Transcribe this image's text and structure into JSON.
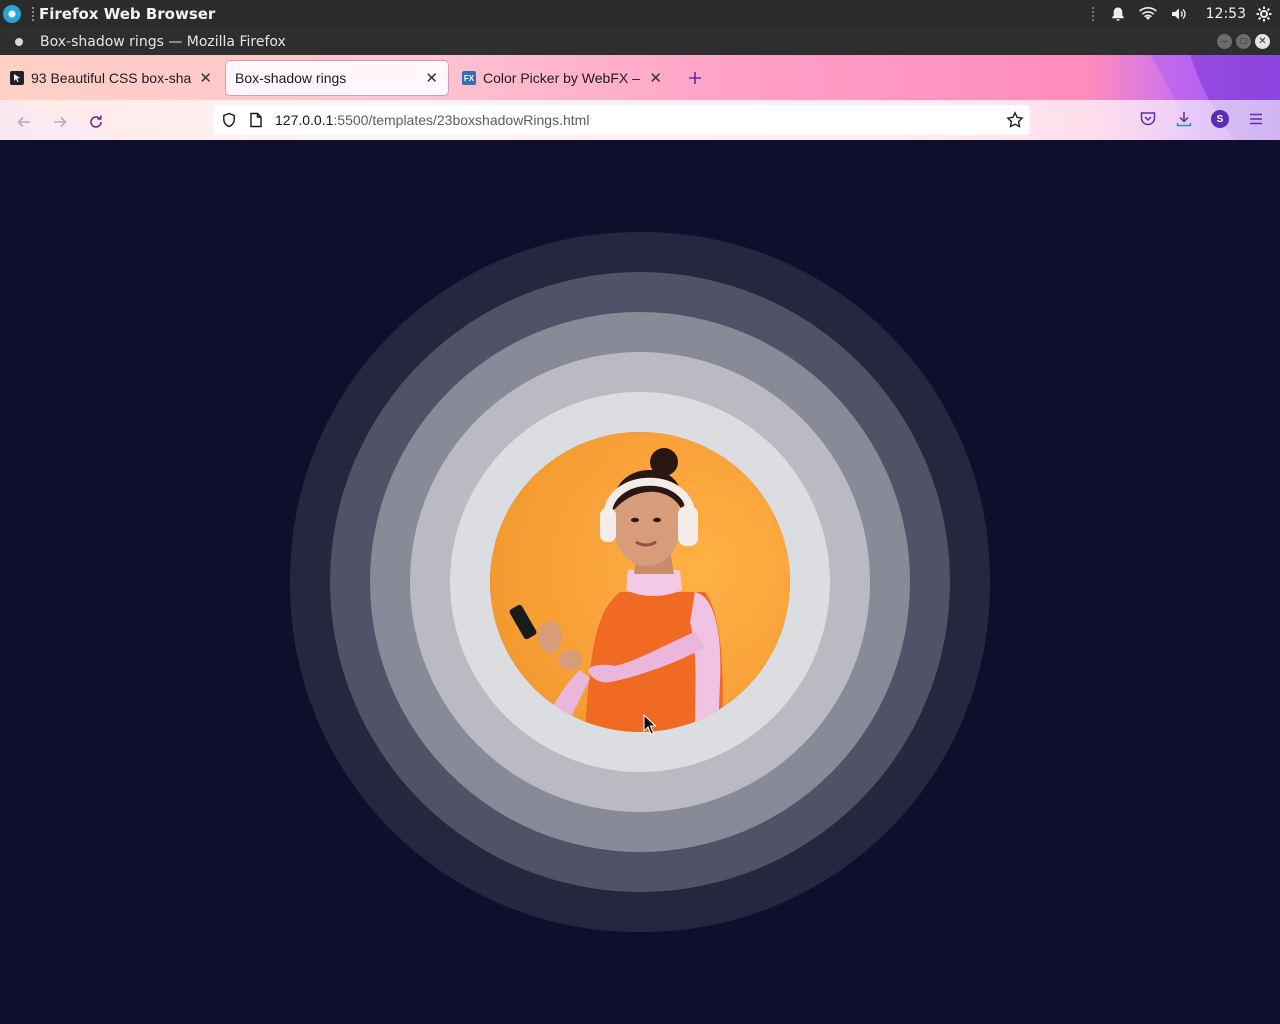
{
  "system_panel": {
    "app_name": "Firefox Web Browser",
    "clock": "12:53",
    "icons": [
      "notifications-icon",
      "wifi-icon",
      "volume-icon",
      "settings-icon"
    ]
  },
  "window": {
    "title": "Box-shadow rings — Mozilla Firefox"
  },
  "tabs": [
    {
      "label": "93 Beautiful CSS box-sha",
      "favicon": "dark-cursor-favicon",
      "active": false
    },
    {
      "label": "Box-shadow rings",
      "favicon": "none",
      "active": true
    },
    {
      "label": "Color Picker by WebFX – ",
      "favicon": "fx-favicon",
      "active": false
    }
  ],
  "urlbar": {
    "host": "127.0.0.1",
    "path": ":5500/templates/23boxshadowRings.html"
  },
  "toolbar": {
    "account_initial": "S"
  },
  "page": {
    "background": "#0e0f2c",
    "ring_colors": [
      "#dcdde1",
      "#b9bac2",
      "#888a98",
      "#505268",
      "#25273f"
    ],
    "image_subject": "woman with headphones holding phone on orange background"
  }
}
